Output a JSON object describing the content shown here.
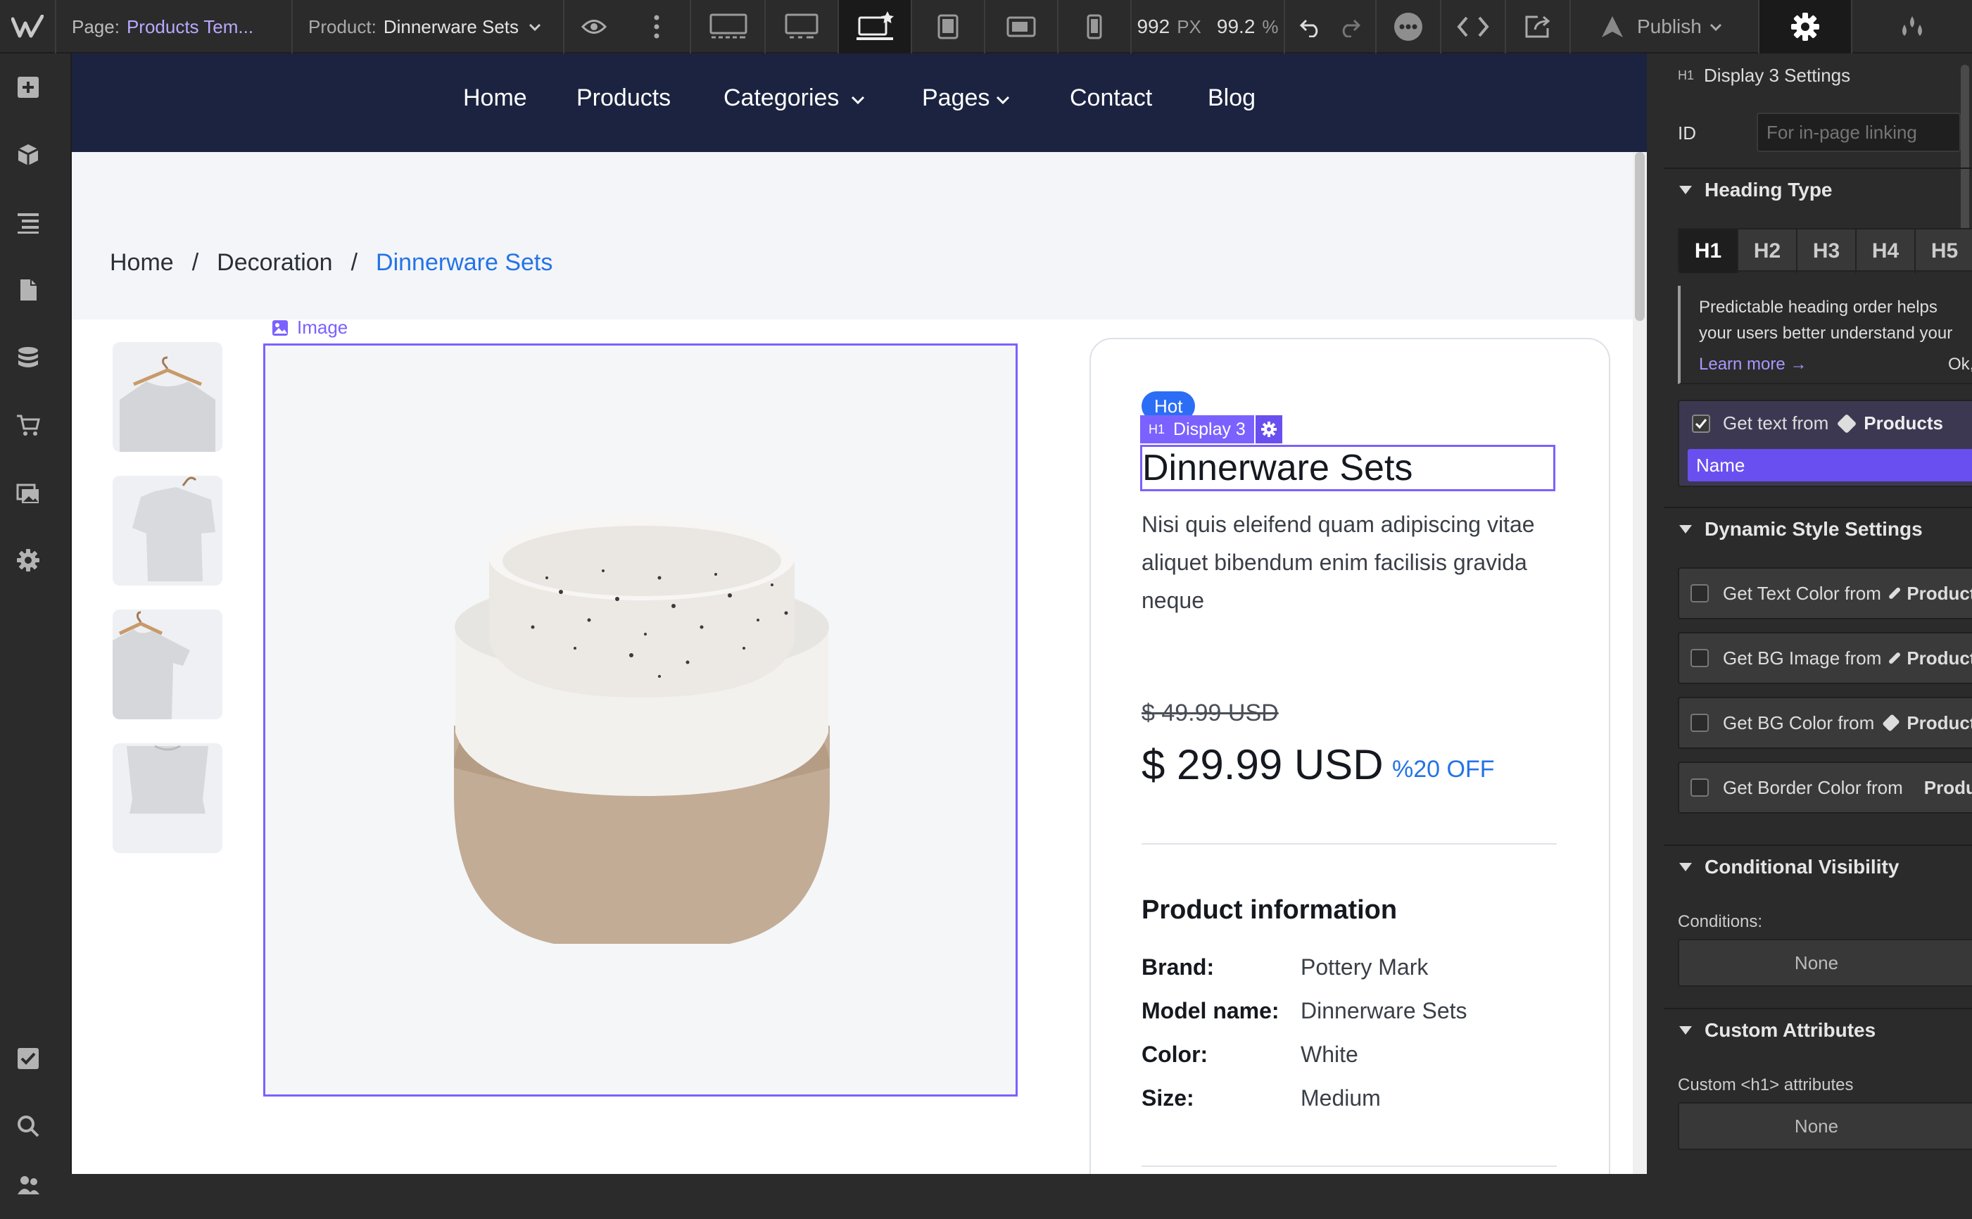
{
  "topbar": {
    "page_label": "Page:",
    "page_name": "Products Tem...",
    "product_label": "Product:",
    "product_name": "Dinnerware Sets",
    "width_value": "992",
    "width_unit": "PX",
    "zoom_value": "99.2",
    "zoom_unit": "%",
    "publish_label": "Publish"
  },
  "leftbar": {
    "icons": [
      "add-icon",
      "cube-icon",
      "navigator-icon",
      "pages-icon",
      "cms-icon",
      "ecommerce-icon",
      "assets-icon",
      "settings-icon",
      "tasks-icon",
      "search-icon",
      "users-icon"
    ]
  },
  "site": {
    "nav": [
      "Home",
      "Products",
      "Categories",
      "Pages",
      "Contact",
      "Blog"
    ],
    "breadcrumb": [
      "Home",
      "Decoration",
      "Dinnerware Sets"
    ],
    "breadcrumb_sep": "/",
    "image_label": "Image",
    "badge": "Hot",
    "selection_tag_level": "H1",
    "selection_tag_name": "Display 3",
    "title": "Dinnerware Sets",
    "description": "Nisi quis eleifend quam adipiscing vitae aliquet bibendum enim facilisis gravida neque",
    "old_price": "$ 49.99 USD",
    "price": "$ 29.99 USD",
    "discount": "%20 OFF",
    "info_heading": "Product information",
    "info": [
      {
        "label": "Brand:",
        "value": "Pottery Mark"
      },
      {
        "label": "Model name:",
        "value": "Dinnerware Sets"
      },
      {
        "label": "Color:",
        "value": "White"
      },
      {
        "label": "Size:",
        "value": "Medium"
      }
    ]
  },
  "panel": {
    "header_level": "H1",
    "header_title": "Display 3 Settings",
    "id_label": "ID",
    "id_placeholder": "For in-page linking",
    "heading_type_title": "Heading Type",
    "heading_buttons": [
      "H1",
      "H2",
      "H3",
      "H4",
      "H5"
    ],
    "heading_selected": "H1",
    "notice_text": "Predictable heading order helps your users better understand your content.",
    "notice_learn": "Learn more →",
    "notice_ok": "Ok, got it",
    "get_text_label": "Get text from",
    "get_text_source": "Products",
    "get_text_field": "Name",
    "dynamic_title": "Dynamic Style Settings",
    "dynamic_rows": [
      {
        "label": "Get Text Color from",
        "source": "Products"
      },
      {
        "label": "Get BG Image from",
        "source": "Products"
      },
      {
        "label": "Get BG Color from",
        "source": "Products"
      },
      {
        "label": "Get Border Color from",
        "source": "Products"
      }
    ],
    "conditional_title": "Conditional Visibility",
    "conditions_label": "Conditions:",
    "conditions_value": "None",
    "custom_title": "Custom Attributes",
    "custom_label": "Custom <h1> attributes",
    "custom_value": "None"
  },
  "colors": {
    "accent_purple": "#7b61ff",
    "link_blue": "#2473e6",
    "nav_bg": "#1b2340",
    "hot_badge": "#2b6ef5"
  }
}
